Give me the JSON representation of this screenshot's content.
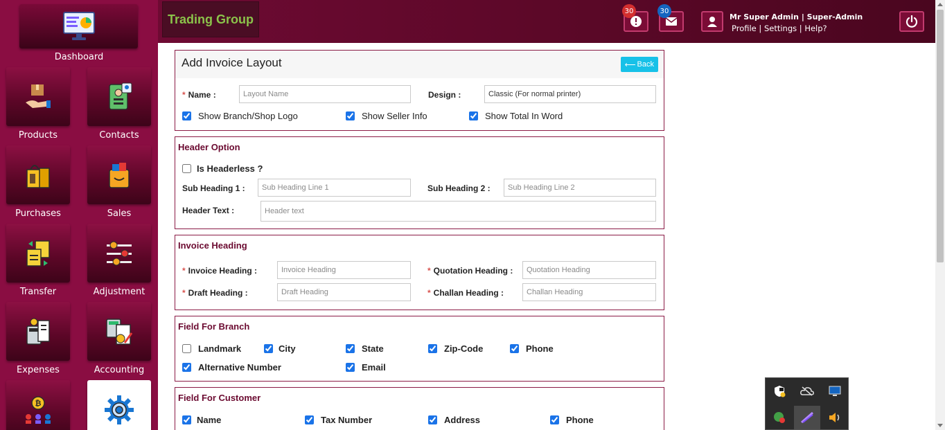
{
  "sidebar": {
    "dashboard_label": "Dashboard",
    "items": [
      {
        "label": "Products",
        "icon": "products-icon"
      },
      {
        "label": "Contacts",
        "icon": "contacts-icon"
      },
      {
        "label": "Purchases",
        "icon": "purchases-icon"
      },
      {
        "label": "Sales",
        "icon": "sales-icon"
      },
      {
        "label": "Transfer",
        "icon": "transfer-icon"
      },
      {
        "label": "Adjustment",
        "icon": "adjustment-icon"
      },
      {
        "label": "Expenses",
        "icon": "expenses-icon"
      },
      {
        "label": "Accounting",
        "icon": "accounting-icon"
      },
      {
        "label": "",
        "icon": "hrm-icon"
      },
      {
        "label": "",
        "icon": "settings-icon"
      }
    ]
  },
  "topbar": {
    "brand": "Trading Group",
    "alerts_count": "30",
    "messages_count": "30",
    "user_name": "Mr Super Admin | Super-Admin",
    "profile_link": "Profile",
    "settings_link": "Settings",
    "help_link": "Help?",
    "separator": " | "
  },
  "form": {
    "title": "Add Invoice Layout",
    "back_label": "Back",
    "name_label": "Name :",
    "name_placeholder": "Layout Name",
    "design_label": "Design :",
    "design_value": "Classic (For normal printer)",
    "show_logo": "Show Branch/Shop Logo",
    "show_seller": "Show Seller Info",
    "show_total_word": "Show Total In Word"
  },
  "header_option": {
    "title": "Header Option",
    "headerless": "Is Headerless ?",
    "sub1_label": "Sub Heading 1 :",
    "sub1_placeholder": "Sub Heading Line 1",
    "sub2_label": "Sub Heading 2 :",
    "sub2_placeholder": "Sub Heading Line 2",
    "header_text_label": "Header Text :",
    "header_text_placeholder": "Header text"
  },
  "invoice_heading": {
    "title": "Invoice Heading",
    "invoice_label": "Invoice Heading :",
    "invoice_placeholder": "Invoice Heading",
    "quotation_label": "Quotation Heading :",
    "quotation_placeholder": "Quotation Heading",
    "draft_label": "Draft Heading :",
    "draft_placeholder": "Draft Heading",
    "challan_label": "Challan Heading :",
    "challan_placeholder": "Challan Heading"
  },
  "branch_fields": {
    "title": "Field For Branch",
    "landmark": "Landmark",
    "city": "City",
    "state": "State",
    "zip": "Zip-Code",
    "phone": "Phone",
    "alt_number": "Alternative Number",
    "email": "Email"
  },
  "customer_fields": {
    "title": "Field For Customer",
    "name": "Name",
    "tax_number": "Tax Number",
    "address": "Address",
    "phone": "Phone"
  },
  "colors": {
    "sidebar": "#8a0d42",
    "topbar": "#5c0828",
    "accent": "#6b0a30",
    "back_button": "#17c1e8",
    "brand_text": "#8bc34a"
  }
}
